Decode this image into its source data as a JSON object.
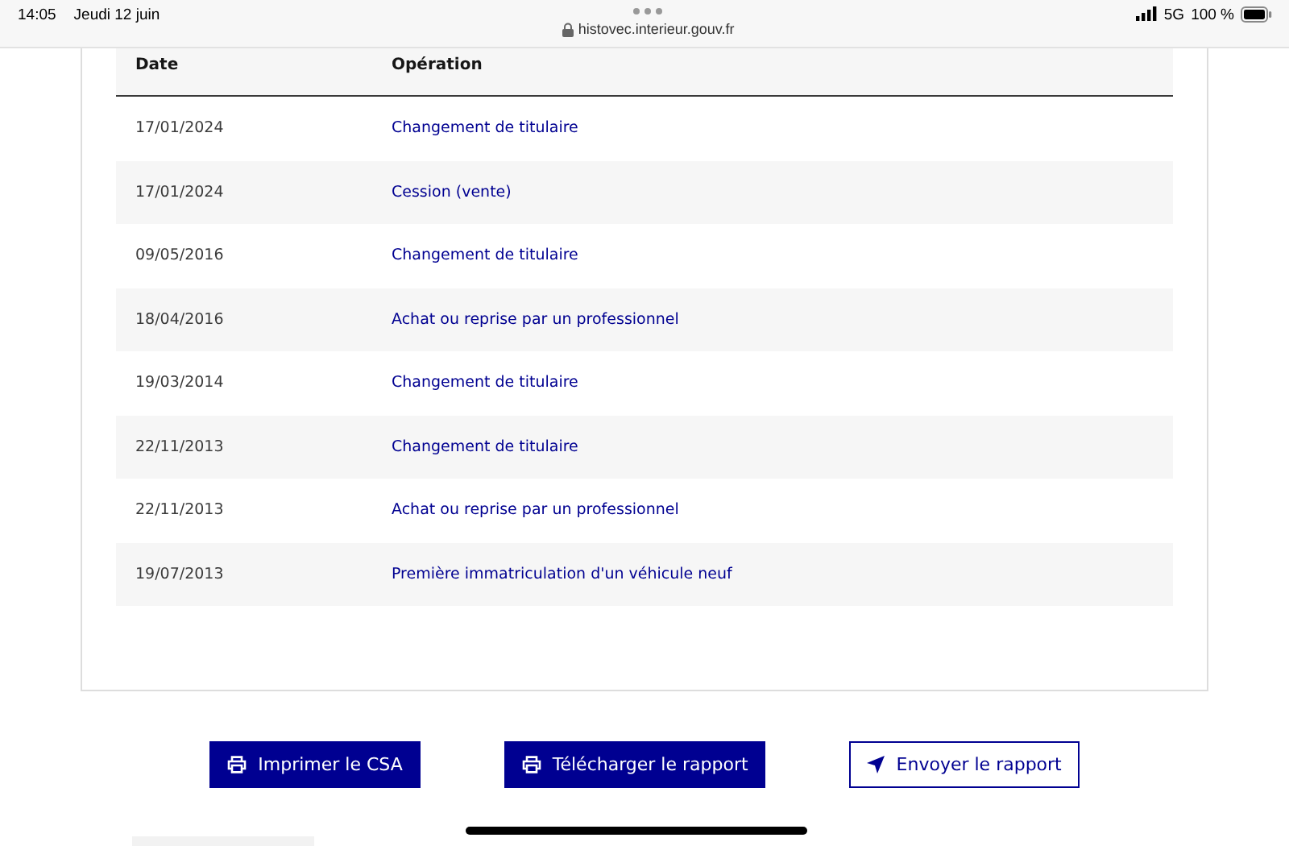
{
  "status_bar": {
    "time": "14:05",
    "date": "Jeudi 12 juin",
    "url": "histovec.interieur.gouv.fr",
    "network": "5G",
    "battery": "100 %"
  },
  "table": {
    "columns": [
      "Date",
      "Opération"
    ],
    "rows": [
      {
        "date": "17/01/2024",
        "operation": "Changement de titulaire"
      },
      {
        "date": "17/01/2024",
        "operation": "Cession (vente)"
      },
      {
        "date": "09/05/2016",
        "operation": "Changement de titulaire"
      },
      {
        "date": "18/04/2016",
        "operation": "Achat ou reprise par un professionnel"
      },
      {
        "date": "19/03/2014",
        "operation": "Changement de titulaire"
      },
      {
        "date": "22/11/2013",
        "operation": "Changement de titulaire"
      },
      {
        "date": "22/11/2013",
        "operation": "Achat ou reprise par un professionnel"
      },
      {
        "date": "19/07/2013",
        "operation": "Première immatriculation d'un véhicule neuf"
      }
    ]
  },
  "buttons": [
    {
      "label": "Imprimer le CSA",
      "kind": "primary"
    },
    {
      "label": "Télécharger le rapport",
      "kind": "primary"
    },
    {
      "label": "Envoyer le rapport",
      "kind": "secondary"
    }
  ]
}
